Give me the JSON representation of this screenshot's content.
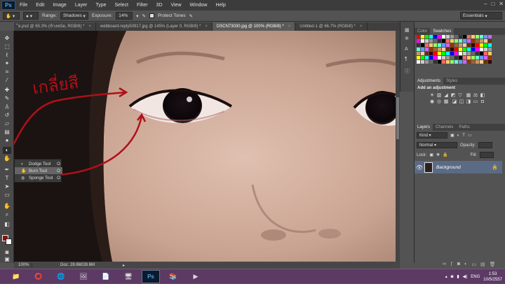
{
  "app": {
    "logo": "Ps"
  },
  "menu": [
    "File",
    "Edit",
    "Image",
    "Layer",
    "Type",
    "Select",
    "Filter",
    "3D",
    "View",
    "Window",
    "Help"
  ],
  "window_controls": [
    "–",
    "□",
    "✕"
  ],
  "options": {
    "range_label": "Range:",
    "range_value": "Shadows",
    "exposure_label": "Exposure:",
    "exposure_value": "14%",
    "protect_label": "Protect Tones",
    "workspace": "Essentials"
  },
  "tabs": [
    {
      "label": "ีย.psd @ 65.3% (ข้างหน้อ, RGB/8) *",
      "close": "×"
    },
    {
      "label": "webboard-reply50917.jpg @ 145% (Layer 0, RGB/8) *",
      "close": "×"
    },
    {
      "label": "DSCN73030.jpg @ 100% (RGB/8) *",
      "close": "×"
    },
    {
      "label": "Untitled-1 @ 66.7% (RGB/8) *",
      "close": "×"
    }
  ],
  "flyout": [
    {
      "label": "Dodge Tool",
      "key": "O",
      "icon": "◐"
    },
    {
      "label": "Burn Tool",
      "key": "O",
      "icon": "✋"
    },
    {
      "label": "Sponge Tool",
      "key": "O",
      "icon": "◍"
    }
  ],
  "annotation_text": "เกลี่ยสี",
  "status": {
    "zoom": "100%",
    "doc": "Doc: 28.6M/28.6M"
  },
  "panels": {
    "color_tab": "Color",
    "swatches_tab": "Swatches",
    "adjustments_tab": "Adjustments",
    "styles_tab": "Styles",
    "add_adjustment": "Add an adjustment",
    "layers_tab": "Layers",
    "channels_tab": "Channels",
    "paths_tab": "Paths",
    "kind": "Kind",
    "blend_mode": "Normal",
    "opacity_label": "Opacity:",
    "fill_label": "Fill:",
    "lock_label": "Lock:",
    "layer_name": "Background"
  },
  "tray": {
    "lang": "ENG",
    "time": "1:53",
    "date": "10/5/2557"
  },
  "colors": {
    "fg": "#8b1010",
    "bg": "#ffffff",
    "annotation": "#b0101a"
  }
}
